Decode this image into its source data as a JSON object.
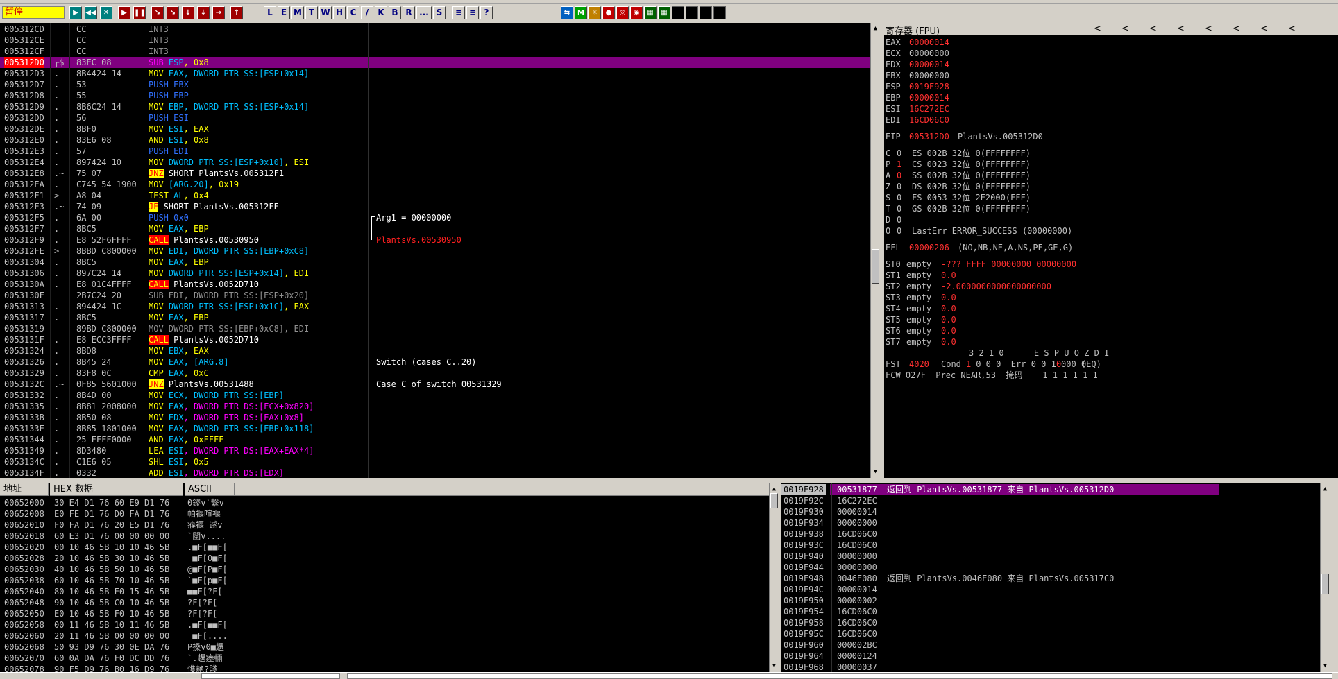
{
  "toolbar": {
    "status": "暂停",
    "left_buttons": [
      "▶",
      "◀◀",
      "✕",
      "▶",
      "❚❚",
      "↘",
      "↘",
      "↓",
      "↓",
      "→",
      "↑"
    ],
    "letter_buttons": [
      "L",
      "E",
      "M",
      "T",
      "W",
      "H",
      "C",
      "/",
      "K",
      "B",
      "R",
      "...",
      "S"
    ],
    "mid_buttons": [
      "≡",
      "≡",
      "?"
    ],
    "right_buttons": [
      "⇆",
      "M",
      "☼",
      "●",
      "◎",
      "◉",
      "▦",
      "▦"
    ]
  },
  "disasm": {
    "rows": [
      {
        "addr": "005312CD",
        "sym": "",
        "hex": "CC",
        "asm": [
          [
            "INT3",
            "g"
          ]
        ]
      },
      {
        "addr": "005312CE",
        "sym": "",
        "hex": "CC",
        "asm": [
          [
            "INT3",
            "g"
          ]
        ]
      },
      {
        "addr": "005312CF",
        "sym": "",
        "hex": "CC",
        "asm": [
          [
            "INT3",
            "g"
          ]
        ]
      },
      {
        "addr": "005312D0",
        "sym": "┌$",
        "hex": "83EC 08",
        "asm": [
          [
            "SUB ",
            "m"
          ],
          [
            "ESP",
            "b"
          ],
          [
            ", 0x8",
            "y"
          ]
        ],
        "selected": true
      },
      {
        "addr": "005312D3",
        "sym": ".",
        "hex": "8B4424 14",
        "asm": [
          [
            "MOV ",
            "y"
          ],
          [
            "EAX",
            "b"
          ],
          [
            ", DWORD PTR SS:[ESP+0x14]",
            "b"
          ]
        ]
      },
      {
        "addr": "005312D7",
        "sym": ".",
        "hex": "53",
        "asm": [
          [
            "PUSH EBX",
            "blue2"
          ]
        ]
      },
      {
        "addr": "005312D8",
        "sym": ".",
        "hex": "55",
        "asm": [
          [
            "PUSH EBP",
            "blue2"
          ]
        ]
      },
      {
        "addr": "005312D9",
        "sym": ".",
        "hex": "8B6C24 14",
        "asm": [
          [
            "MOV ",
            "y"
          ],
          [
            "EBP",
            "b"
          ],
          [
            ", DWORD PTR SS:[ESP+0x14]",
            "b"
          ]
        ]
      },
      {
        "addr": "005312DD",
        "sym": ".",
        "hex": "56",
        "asm": [
          [
            "PUSH ESI",
            "blue2"
          ]
        ]
      },
      {
        "addr": "005312DE",
        "sym": ".",
        "hex": "8BF0",
        "asm": [
          [
            "MOV ",
            "y"
          ],
          [
            "ESI",
            "b"
          ],
          [
            ", EAX",
            "y"
          ]
        ]
      },
      {
        "addr": "005312E0",
        "sym": ".",
        "hex": "83E6 08",
        "asm": [
          [
            "AND ",
            "y"
          ],
          [
            "ESI",
            "b"
          ],
          [
            ", 0x8",
            "y"
          ]
        ]
      },
      {
        "addr": "005312E3",
        "sym": ".",
        "hex": "57",
        "asm": [
          [
            "PUSH EDI",
            "blue2"
          ]
        ]
      },
      {
        "addr": "005312E4",
        "sym": ".",
        "hex": "897424 10",
        "asm": [
          [
            "MOV ",
            "y"
          ],
          [
            "DWORD PTR SS:[ESP+0x10]",
            "b"
          ],
          [
            ", ESI",
            "y"
          ]
        ]
      },
      {
        "addr": "005312E8",
        "sym": ".~",
        "hex": "75 07",
        "asm": [
          [
            "JNZ",
            "jmp"
          ],
          [
            " SHORT PlantsVs.005312F1",
            "w"
          ]
        ]
      },
      {
        "addr": "005312EA",
        "sym": ".",
        "hex": "C745 54 1900",
        "asm": [
          [
            "MOV ",
            "y"
          ],
          [
            "[ARG.20]",
            "b"
          ],
          [
            ", 0x19",
            "y"
          ]
        ]
      },
      {
        "addr": "005312F1",
        "sym": ">",
        "hex": "A8 04",
        "asm": [
          [
            "TEST ",
            "y"
          ],
          [
            "AL",
            "b"
          ],
          [
            ", 0x4",
            "y"
          ]
        ]
      },
      {
        "addr": "005312F3",
        "sym": ".~",
        "hex": "74 09",
        "asm": [
          [
            "JE",
            "jmp"
          ],
          [
            " SHORT PlantsVs.005312FE",
            "w"
          ]
        ]
      },
      {
        "addr": "005312F5",
        "sym": ".",
        "hex": "6A 00",
        "asm": [
          [
            "PUSH 0x0",
            "blue2"
          ]
        ]
      },
      {
        "addr": "005312F7",
        "sym": ".",
        "hex": "8BC5",
        "asm": [
          [
            "MOV ",
            "y"
          ],
          [
            "EAX",
            "b"
          ],
          [
            ", EBP",
            "y"
          ]
        ]
      },
      {
        "addr": "005312F9",
        "sym": ".",
        "hex": "E8 52F6FFFF",
        "asm": [
          [
            "CALL",
            "call"
          ],
          [
            " PlantsVs.00530950",
            "w"
          ]
        ]
      },
      {
        "addr": "005312FE",
        "sym": ">",
        "hex": "8BBD C800000",
        "asm": [
          [
            "MOV ",
            "y"
          ],
          [
            "EDI",
            "b"
          ],
          [
            ", DWORD PTR SS:[EBP+0xC8]",
            "b"
          ]
        ]
      },
      {
        "addr": "00531304",
        "sym": ".",
        "hex": "8BC5",
        "asm": [
          [
            "MOV ",
            "y"
          ],
          [
            "EAX",
            "b"
          ],
          [
            ", EBP",
            "y"
          ]
        ]
      },
      {
        "addr": "00531306",
        "sym": ".",
        "hex": "897C24 14",
        "asm": [
          [
            "MOV ",
            "y"
          ],
          [
            "DWORD PTR SS:[ESP+0x14]",
            "b"
          ],
          [
            ", EDI",
            "y"
          ]
        ]
      },
      {
        "addr": "0053130A",
        "sym": ".",
        "hex": "E8 01C4FFFF",
        "asm": [
          [
            "CALL",
            "call"
          ],
          [
            " PlantsVs.0052D710",
            "w"
          ]
        ]
      },
      {
        "addr": "0053130F",
        "sym": "",
        "hex": "2B7C24 20",
        "asm": [
          [
            "SUB EDI, DWORD PTR SS:[ESP+0x20]",
            "g"
          ]
        ]
      },
      {
        "addr": "00531313",
        "sym": ".",
        "hex": "894424 1C",
        "asm": [
          [
            "MOV ",
            "y"
          ],
          [
            "DWORD PTR SS:[ESP+0x1C]",
            "b"
          ],
          [
            ", EAX",
            "y"
          ]
        ]
      },
      {
        "addr": "00531317",
        "sym": ".",
        "hex": "8BC5",
        "asm": [
          [
            "MOV ",
            "y"
          ],
          [
            "EAX",
            "b"
          ],
          [
            ", EBP",
            "y"
          ]
        ]
      },
      {
        "addr": "00531319",
        "sym": "",
        "hex": "89BD C800000",
        "asm": [
          [
            "MOV DWORD PTR SS:[EBP+0xC8], EDI",
            "g"
          ]
        ]
      },
      {
        "addr": "0053131F",
        "sym": ".",
        "hex": "E8 ECC3FFFF",
        "asm": [
          [
            "CALL",
            "call"
          ],
          [
            " PlantsVs.0052D710",
            "w"
          ]
        ]
      },
      {
        "addr": "00531324",
        "sym": ".",
        "hex": "8BD8",
        "asm": [
          [
            "MOV ",
            "y"
          ],
          [
            "EBX",
            "b"
          ],
          [
            ", EAX",
            "y"
          ]
        ]
      },
      {
        "addr": "00531326",
        "sym": ".",
        "hex": "8B45 24",
        "asm": [
          [
            "MOV ",
            "y"
          ],
          [
            "EAX",
            "b"
          ],
          [
            ", [ARG.8]",
            "b"
          ]
        ]
      },
      {
        "addr": "00531329",
        "sym": ".",
        "hex": "83F8 0C",
        "asm": [
          [
            "CMP ",
            "y"
          ],
          [
            "EAX",
            "b"
          ],
          [
            ", 0xC",
            "y"
          ]
        ]
      },
      {
        "addr": "0053132C",
        "sym": ".~",
        "hex": "0F85 5601000",
        "asm": [
          [
            "JNZ",
            "jmp"
          ],
          [
            " PlantsVs.00531488",
            "w"
          ]
        ]
      },
      {
        "addr": "00531332",
        "sym": ".",
        "hex": "8B4D 00",
        "asm": [
          [
            "MOV ",
            "y"
          ],
          [
            "ECX",
            "b"
          ],
          [
            ", DWORD PTR SS:[EBP]",
            "b"
          ]
        ]
      },
      {
        "addr": "00531335",
        "sym": ".",
        "hex": "8B81 2008000",
        "asm": [
          [
            "MOV ",
            "y"
          ],
          [
            "EAX",
            "b"
          ],
          [
            ", DWORD PTR DS:[ECX+0x820]",
            "m"
          ]
        ]
      },
      {
        "addr": "0053133B",
        "sym": ".",
        "hex": "8B50 08",
        "asm": [
          [
            "MOV ",
            "y"
          ],
          [
            "EDX",
            "b"
          ],
          [
            ", DWORD PTR DS:[EAX+0x8]",
            "m"
          ]
        ]
      },
      {
        "addr": "0053133E",
        "sym": ".",
        "hex": "8B85 1801000",
        "asm": [
          [
            "MOV ",
            "y"
          ],
          [
            "EAX",
            "b"
          ],
          [
            ", DWORD PTR SS:[EBP+0x118]",
            "b"
          ]
        ]
      },
      {
        "addr": "00531344",
        "sym": ".",
        "hex": "25 FFFF0000",
        "asm": [
          [
            "AND ",
            "y"
          ],
          [
            "EAX",
            "b"
          ],
          [
            ", 0xFFFF",
            "y"
          ]
        ]
      },
      {
        "addr": "00531349",
        "sym": ".",
        "hex": "8D3480",
        "asm": [
          [
            "LEA ",
            "y"
          ],
          [
            "ESI",
            "b"
          ],
          [
            ", DWORD PTR DS:[EAX+EAX*4]",
            "m"
          ]
        ]
      },
      {
        "addr": "0053134C",
        "sym": ".",
        "hex": "C1E6 05",
        "asm": [
          [
            "SHL ",
            "y"
          ],
          [
            "ESI",
            "b"
          ],
          [
            ", 0x5",
            "y"
          ]
        ]
      },
      {
        "addr": "0053134F",
        "sym": ".",
        "hex": "0332",
        "asm": [
          [
            "ADD ",
            "y"
          ],
          [
            "ESI",
            "b"
          ],
          [
            ", DWORD PTR DS:[EDX]",
            "m"
          ]
        ]
      }
    ],
    "comments": [
      {
        "row": 17,
        "text": "Arg1 = 00000000",
        "color": "w"
      },
      {
        "row": 19,
        "text": "PlantsVs.00530950",
        "color": "r"
      },
      {
        "row": 30,
        "text": "Switch (cases C..20)",
        "color": "w"
      },
      {
        "row": 32,
        "text": "Case C of switch 00531329",
        "color": "w"
      }
    ]
  },
  "registers": {
    "title": "寄存器 (FPU)",
    "nav_arrows": [
      "<",
      "<",
      "<",
      "<",
      "<",
      "<",
      "<",
      "<"
    ],
    "gp": [
      {
        "name": "EAX",
        "value": "00000014",
        "changed": true
      },
      {
        "name": "ECX",
        "value": "00000000",
        "changed": false
      },
      {
        "name": "EDX",
        "value": "00000014",
        "changed": true
      },
      {
        "name": "EBX",
        "value": "00000000",
        "changed": false
      },
      {
        "name": "ESP",
        "value": "0019F928",
        "changed": true
      },
      {
        "name": "EBP",
        "value": "00000014",
        "changed": true
      },
      {
        "name": "ESI",
        "value": "16C272EC",
        "changed": true
      },
      {
        "name": "EDI",
        "value": "16CD06C0",
        "changed": true
      }
    ],
    "eip": {
      "name": "EIP",
      "value": "005312D0",
      "label": "PlantsVs.005312D0"
    },
    "flags": [
      {
        "f": "C",
        "v": "0",
        "vchanged": false,
        "seg": "ES 002B 32位 0(FFFFFFFF)"
      },
      {
        "f": "P",
        "v": "1",
        "vchanged": true,
        "seg": "CS 0023 32位 0(FFFFFFFF)"
      },
      {
        "f": "A",
        "v": "0",
        "vchanged": true,
        "seg": "SS 002B 32位 0(FFFFFFFF)"
      },
      {
        "f": "Z",
        "v": "0",
        "vchanged": false,
        "seg": "DS 002B 32位 0(FFFFFFFF)"
      },
      {
        "f": "S",
        "v": "0",
        "vchanged": false,
        "seg": "FS 0053 32位 2E2000(FFF)"
      },
      {
        "f": "T",
        "v": "0",
        "vchanged": false,
        "seg": "GS 002B 32位 0(FFFFFFFF)"
      },
      {
        "f": "D",
        "v": "0",
        "vchanged": false,
        "seg": ""
      },
      {
        "f": "O",
        "v": "0",
        "vchanged": false,
        "seg": "LastErr ERROR_SUCCESS (00000000)"
      }
    ],
    "efl": {
      "name": "EFL",
      "value": "00000206",
      "desc": "(NO,NB,NE,A,NS,PE,GE,G)"
    },
    "fpu": [
      {
        "name": "ST0",
        "state": "empty",
        "value": "-??? FFFF 00000000 00000000"
      },
      {
        "name": "ST1",
        "state": "empty",
        "value": "0.0"
      },
      {
        "name": "ST2",
        "state": "empty",
        "value": "-2.0000000000000000000"
      },
      {
        "name": "ST3",
        "state": "empty",
        "value": "0.0"
      },
      {
        "name": "ST4",
        "state": "empty",
        "value": "0.0"
      },
      {
        "name": "ST5",
        "state": "empty",
        "value": "0.0"
      },
      {
        "name": "ST6",
        "state": "empty",
        "value": "0.0"
      },
      {
        "name": "ST7",
        "state": "empty",
        "value": "0.0"
      }
    ],
    "fst_header": "3 2 1 0      E S P U O Z D I",
    "fst": {
      "label": "FST",
      "value": "4020",
      "rest1": "Cond ",
      "c3": "1",
      "rest2": " 0 0 0  Err 0 0 1 0 0 0 ",
      "err": "0",
      "rest3": " 0  (EQ)"
    },
    "fcw": "FCW 027F  Prec NEAR,53  掩码    1 1 1 1 1 1"
  },
  "dump": {
    "headers": [
      "地址",
      "HEX 数据",
      "ASCII"
    ],
    "rows": [
      {
        "addr": "00652000",
        "hex": "30 E4 D1 76 60 E9 D1 76",
        "ascii": "0鑁v`繫v"
      },
      {
        "addr": "00652008",
        "hex": "E0 FE D1 76 D0 FA D1 76",
        "ascii": "帕褗喧褗"
      },
      {
        "addr": "00652010",
        "hex": "F0 FA D1 76 20 E5 D1 76",
        "ascii": "瘊褗 逑v"
      },
      {
        "addr": "00652018",
        "hex": "60 E3 D1 76 00 00 00 00",
        "ascii": "`闉v...."
      },
      {
        "addr": "00652020",
        "hex": "00 10 46 5B 10 10 46 5B",
        "ascii": ".■F[■■F["
      },
      {
        "addr": "00652028",
        "hex": "20 10 46 5B 30 10 46 5B",
        "ascii": " ■F[0■F["
      },
      {
        "addr": "00652030",
        "hex": "40 10 46 5B 50 10 46 5B",
        "ascii": "@■F[P■F["
      },
      {
        "addr": "00652038",
        "hex": "60 10 46 5B 70 10 46 5B",
        "ascii": "`■F[p■F["
      },
      {
        "addr": "00652040",
        "hex": "80 10 46 5B E0 15 46 5B",
        "ascii": "■■F[?F["
      },
      {
        "addr": "00652048",
        "hex": "90 10 46 5B C0 10 46 5B",
        "ascii": "?F[?F["
      },
      {
        "addr": "00652050",
        "hex": "E0 10 46 5B F0 10 46 5B",
        "ascii": "?F[?F["
      },
      {
        "addr": "00652058",
        "hex": "00 11 46 5B 10 11 46 5B",
        "ascii": ".■F[■■F["
      },
      {
        "addr": "00652060",
        "hex": "20 11 46 5B 00 00 00 00",
        "ascii": " ■F[...."
      },
      {
        "addr": "00652068",
        "hex": "50 93 D9 76 30 0E DA 76",
        "ascii": "P搡v0■趩"
      },
      {
        "addr": "00652070",
        "hex": "60 0A DA 76 F0 DC DD 76",
        "ascii": "`.趩瘗輛"
      },
      {
        "addr": "00652078",
        "hex": "90 F5 D9 76 B0 16 D9 76",
        "ascii": "愯赩?賤"
      }
    ]
  },
  "stack": {
    "rows": [
      {
        "addr": "0019F928",
        "value": "00531877",
        "comment": "返回到 PlantsVs.00531877 来自 PlantsVs.005312D0",
        "selected": true
      },
      {
        "addr": "0019F92C",
        "value": "16C272EC",
        "comment": ""
      },
      {
        "addr": "0019F930",
        "value": "00000014",
        "comment": ""
      },
      {
        "addr": "0019F934",
        "value": "00000000",
        "comment": ""
      },
      {
        "addr": "0019F938",
        "value": "16CD06C0",
        "comment": ""
      },
      {
        "addr": "0019F93C",
        "value": "16CD06C0",
        "comment": ""
      },
      {
        "addr": "0019F940",
        "value": "00000000",
        "comment": ""
      },
      {
        "addr": "0019F944",
        "value": "00000000",
        "comment": ""
      },
      {
        "addr": "0019F948",
        "value": "0046E080",
        "comment": "返回到 PlantsVs.0046E080 来自 PlantsVs.005317C0"
      },
      {
        "addr": "0019F94C",
        "value": "00000014",
        "comment": ""
      },
      {
        "addr": "0019F950",
        "value": "00000002",
        "comment": ""
      },
      {
        "addr": "0019F954",
        "value": "16CD06C0",
        "comment": ""
      },
      {
        "addr": "0019F958",
        "value": "16CD06C0",
        "comment": ""
      },
      {
        "addr": "0019F95C",
        "value": "16CD06C0",
        "comment": ""
      },
      {
        "addr": "0019F960",
        "value": "000002BC",
        "comment": ""
      },
      {
        "addr": "0019F964",
        "value": "00000124",
        "comment": ""
      },
      {
        "addr": "0019F968",
        "value": "00000037",
        "comment": ""
      }
    ]
  }
}
